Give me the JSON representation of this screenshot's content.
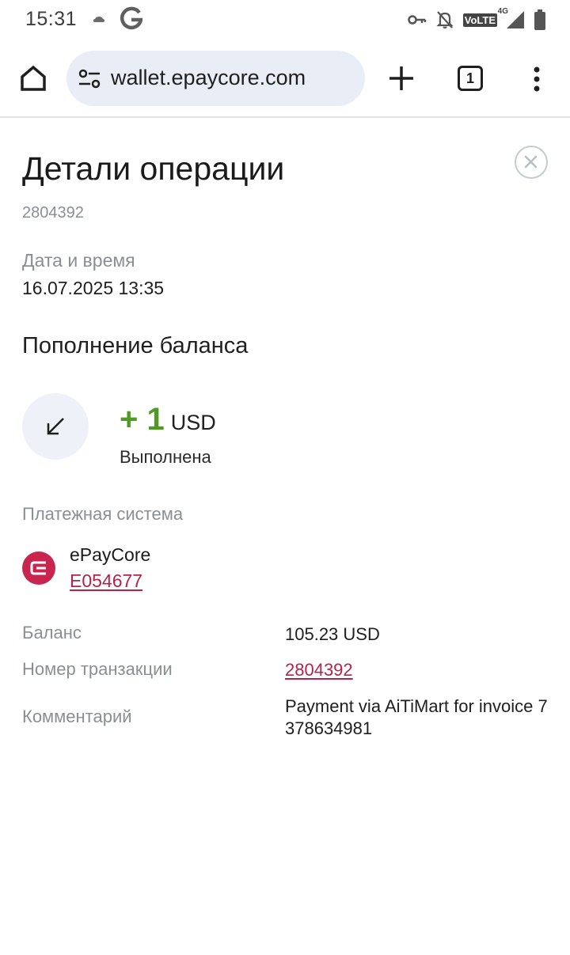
{
  "status_bar": {
    "time": "15:31",
    "icons": [
      "cloud-icon",
      "google-icon",
      "key-icon",
      "bell-off-icon",
      "volte-icon",
      "signal-icon",
      "battery-icon"
    ],
    "volte": "VoLTE",
    "network": "4G"
  },
  "browser": {
    "url": "wallet.epaycore.com",
    "tab_count": "1"
  },
  "page": {
    "title": "Детали операции",
    "operation_id": "2804392",
    "datetime_label": "Дата и время",
    "datetime_value": "16.07.2025 13:35",
    "operation_type": "Пополнение баланса",
    "amount": "+ 1",
    "currency": "USD",
    "status": "Выполнена",
    "payment_system_label": "Платежная система",
    "payment_system_name": "ePayCore",
    "payment_system_account": "E054677",
    "balance_label": "Баланс",
    "balance_value": "105.23 USD",
    "transaction_label": "Номер транзакции",
    "transaction_value": "2804392",
    "comment_label": "Комментарий",
    "comment_value": "Payment via AiTiMart for invoice 7378634981"
  },
  "colors": {
    "accent": "#b3234a",
    "logo": "#c8254f",
    "positive_amount": "#4f9a22",
    "muted_text": "#8a8f96",
    "url_bar": "#e9eef6"
  }
}
